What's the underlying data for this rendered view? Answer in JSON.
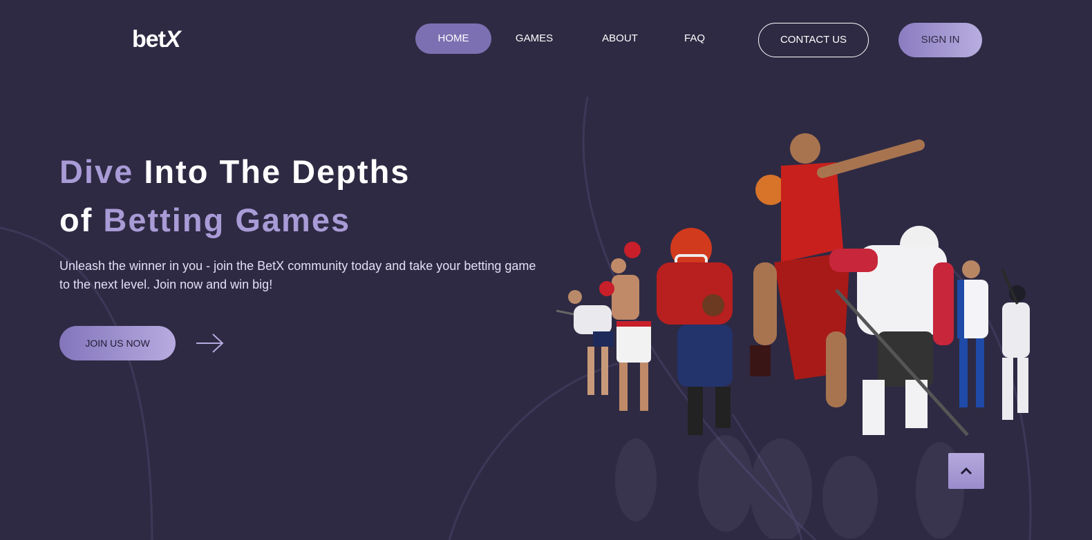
{
  "header": {
    "logo": {
      "prefix": "bet",
      "suffix": "X"
    },
    "nav": [
      {
        "label": "HOME",
        "active": true
      },
      {
        "label": "GAMES",
        "active": false
      },
      {
        "label": "ABOUT",
        "active": false
      },
      {
        "label": "FAQ",
        "active": false
      }
    ],
    "contact_label": "CONTACT US",
    "signin_label": "SIGN IN"
  },
  "hero": {
    "title": {
      "word1": "Dive",
      "word2": " Into The Depths",
      "word3": "of ",
      "word4": "Betting Games"
    },
    "subtitle": "Unleash the winner in you - join the BetX community today and take your betting game to the next level. Join now and win big!",
    "cta_label": "JOIN US NOW",
    "cta_icon": "arrow-right-icon",
    "image": "athletes-collage"
  },
  "scroll_top_icon": "chevron-up-icon",
  "colors": {
    "background": "#2e2a43",
    "accent": "#a89bd6",
    "nav_active": "#7d70b2",
    "button_gradient_start": "#8375bb",
    "button_gradient_end": "#b7abe0"
  }
}
